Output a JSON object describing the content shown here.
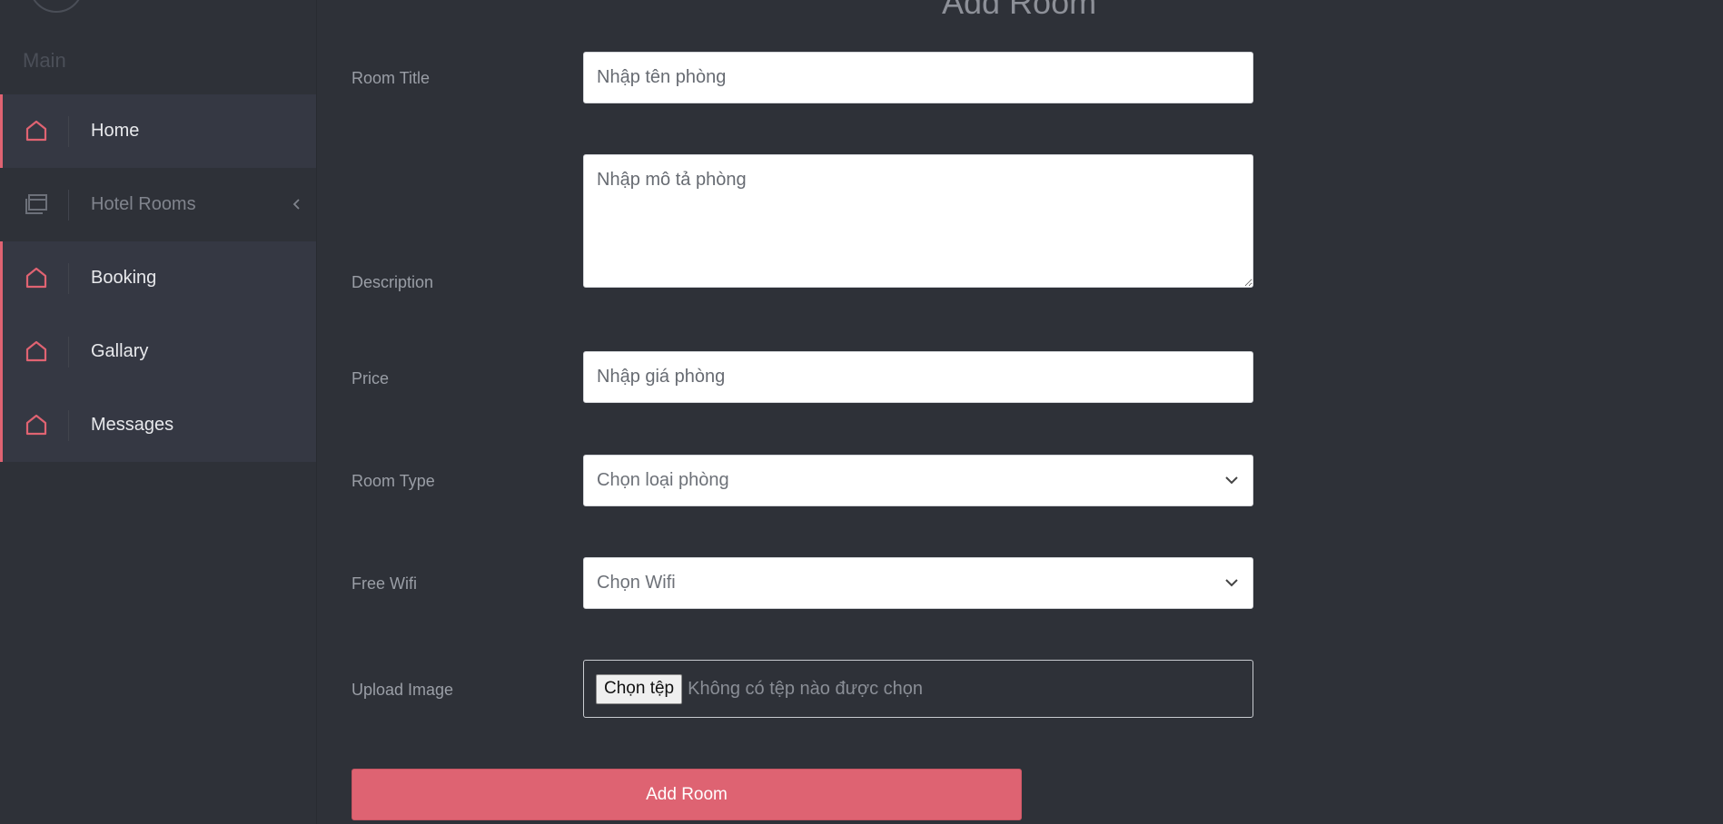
{
  "sidebar": {
    "section_label": "Main",
    "items": [
      {
        "label": "Home",
        "icon": "home-icon"
      },
      {
        "label": "Hotel Rooms",
        "icon": "window-icon"
      },
      {
        "label": "Booking",
        "icon": "home-icon"
      },
      {
        "label": "Gallary",
        "icon": "home-icon"
      },
      {
        "label": "Messages",
        "icon": "home-icon"
      }
    ]
  },
  "main": {
    "title": "Add Room",
    "form": {
      "room_title": {
        "label": "Room Title",
        "placeholder": "Nhập tên phòng"
      },
      "description": {
        "label": "Description",
        "placeholder": "Nhập mô tả phòng"
      },
      "price": {
        "label": "Price",
        "placeholder": "Nhập giá phòng"
      },
      "room_type": {
        "label": "Room Type",
        "value": "Chọn loại phòng"
      },
      "free_wifi": {
        "label": "Free Wifi",
        "value": "Chọn Wifi"
      },
      "upload_image": {
        "label": "Upload Image",
        "button": "Chọn tệp",
        "status": "Không có tệp nào được chọn"
      },
      "submit_label": "Add Room"
    }
  },
  "colors": {
    "background": "#2e3138",
    "accent": "#de6372",
    "active_item": "#353843"
  }
}
